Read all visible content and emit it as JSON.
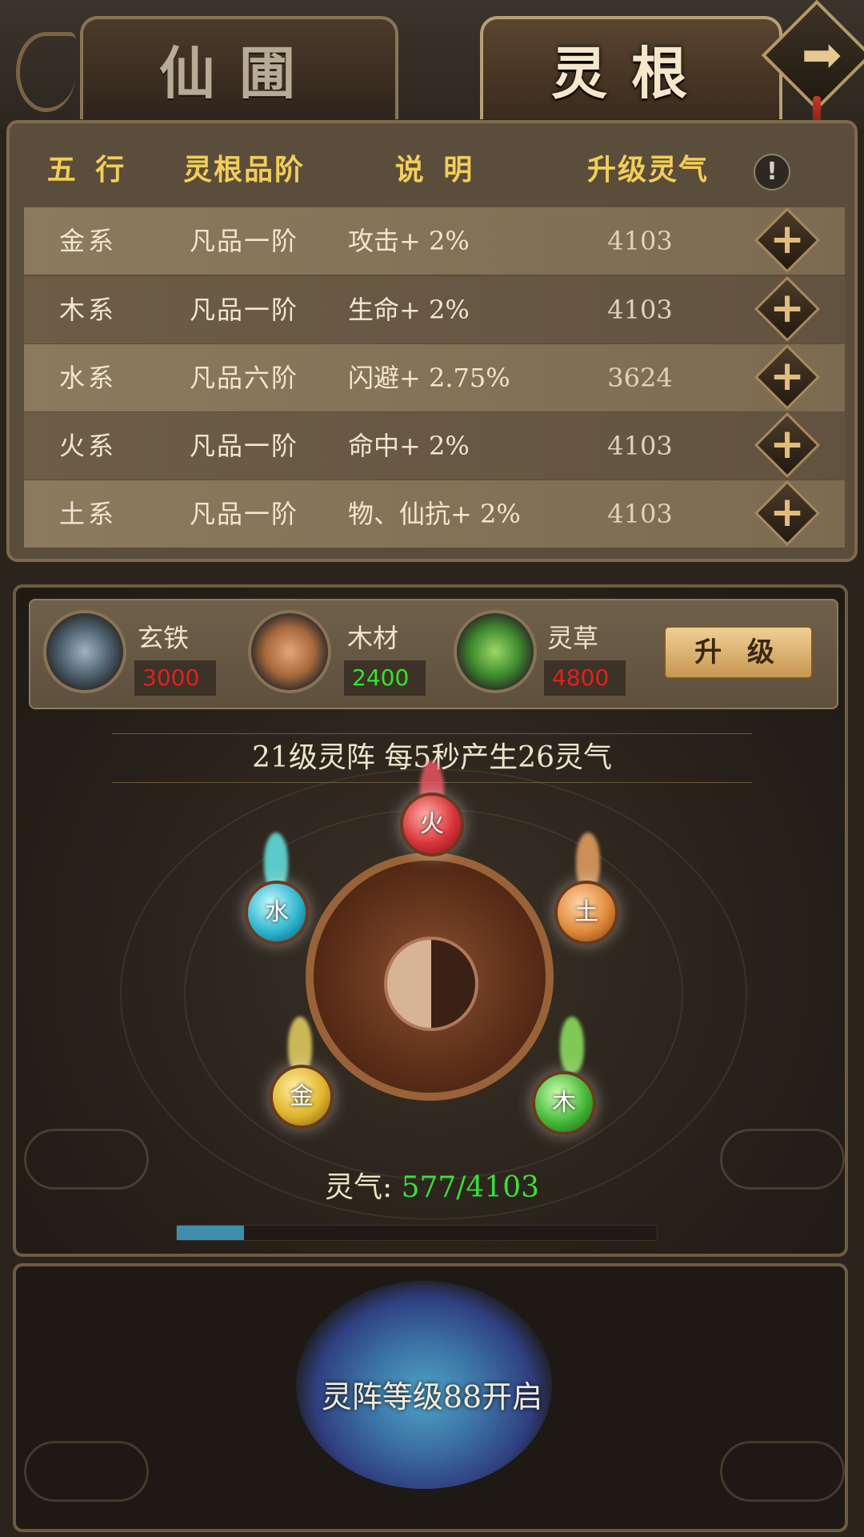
{
  "tabs": [
    {
      "label": "仙圃",
      "active": false
    },
    {
      "label": "灵根",
      "active": true
    }
  ],
  "nav": {
    "next_icon": "arrow-right-icon"
  },
  "table": {
    "headers": [
      "五 行",
      "灵根品阶",
      "说 明",
      "升级灵气"
    ],
    "info_icon": "!",
    "rows": [
      {
        "element": "金系",
        "grade": "凡品一阶",
        "desc": "攻击+ 2%",
        "cost": "4103"
      },
      {
        "element": "木系",
        "grade": "凡品一阶",
        "desc": "生命+ 2%",
        "cost": "4103"
      },
      {
        "element": "水系",
        "grade": "凡品六阶",
        "desc": "闪避+ 2.75%",
        "cost": "3624"
      },
      {
        "element": "火系",
        "grade": "凡品一阶",
        "desc": "命中+ 2%",
        "cost": "4103"
      },
      {
        "element": "土系",
        "grade": "凡品一阶",
        "desc": "物、仙抗+ 2%",
        "cost": "4103"
      }
    ],
    "plus_glyph": "+"
  },
  "resources": [
    {
      "name": "玄铁",
      "value": "3000",
      "color": "#e0221b",
      "icon": "iron-ingot-icon"
    },
    {
      "name": "木材",
      "value": "2400",
      "color": "#35e52a",
      "icon": "wood-logs-icon"
    },
    {
      "name": "灵草",
      "value": "4800",
      "color": "#e0221b",
      "icon": "herb-icon"
    }
  ],
  "upgrade_button": "升 级",
  "array": {
    "title": "21级灵阵  每5秒产生26灵气",
    "orbs": [
      {
        "label": "火",
        "color": "#d9343a"
      },
      {
        "label": "土",
        "color": "#e08a3a"
      },
      {
        "label": "木",
        "color": "#45b83a"
      },
      {
        "label": "金",
        "color": "#e0b42c"
      },
      {
        "label": "水",
        "color": "#2fb5cf"
      }
    ],
    "qi_key": "灵气:",
    "qi_value": "577/4103",
    "progress": 0.14
  },
  "locked": {
    "text": "灵阵等级88开启"
  }
}
